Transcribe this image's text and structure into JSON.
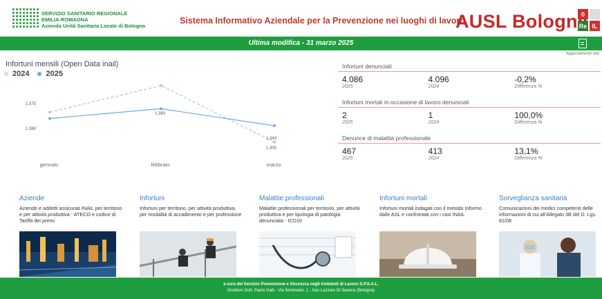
{
  "header": {
    "org_line1": "SERVIZIO SANITARIO REGIONALE",
    "org_line2": "EMILIA-ROMAGNA",
    "org_line3": "Azienda Unità Sanitaria Locale di Bologna",
    "title": "Sistema Informativo Aziendale per la Prevenzione nei luoghi di lavoro",
    "brand": "AUSL Bologna",
    "badge": {
      "zero": "0",
      "re": "Re",
      "il": "IL"
    },
    "brand_color": "#c62828"
  },
  "banner": {
    "last_modified": "Ultima modifica  -  31 marzo 2025",
    "update_label": "Aggiornamento dati",
    "color": "#1f9e3f"
  },
  "chart_data": {
    "type": "line",
    "title": "Infortuni mensili (Open Data inail)",
    "categories": [
      "gennaio",
      "febbraio",
      "marzo"
    ],
    "series": [
      {
        "name": "2024",
        "values": [
          1375,
          1437,
          1305
        ],
        "color": "#a9cbe6",
        "dashed": true
      },
      {
        "name": "2025",
        "values": [
          1360,
          1383,
          1343
        ],
        "color": "#6fa8dc",
        "dashed": false
      }
    ],
    "data_labels": [
      "1.375",
      "1.360",
      "1.383",
      "1.343",
      "1.305"
    ]
  },
  "stats": [
    {
      "heading": "Infortuni denunciati",
      "values": [
        {
          "value": "4.086",
          "label": "2025"
        },
        {
          "value": "4.096",
          "label": "2024"
        },
        {
          "value": "-0,2%",
          "label": "Differenza %"
        }
      ]
    },
    {
      "heading": "Infortuni mortali in occasione di lavoro denunciati",
      "values": [
        {
          "value": "2",
          "label": "2025"
        },
        {
          "value": "1",
          "label": "2024"
        },
        {
          "value": "100,0%",
          "label": "Differenza %"
        }
      ]
    },
    {
      "heading": "Denunce di malattia professionale",
      "values": [
        {
          "value": "467",
          "label": "2025"
        },
        {
          "value": "413",
          "label": "2024"
        },
        {
          "value": "13,1%",
          "label": "Differenza %"
        }
      ]
    }
  ],
  "cards": [
    {
      "title": "Aziende",
      "desc": "Aziende e addetti assicurati INAIL per territorio e per attività produttiva - ATECO e codice di Tariffa dei premi",
      "image": "industrial-plant-image"
    },
    {
      "title": "Infortuni",
      "desc": "Infortuni per territorio, per attività produttiva, per modalità di accadimento e per professione",
      "image": "construction-workers-image"
    },
    {
      "title": "Malattie professionali",
      "desc": "Malattie professionali per territorio, per attività produttiva e per tipologia di patologia denunciata - ICD10",
      "image": "stethoscope-image"
    },
    {
      "title": "Infortuni mortali",
      "desc": "Infortuni mortali indagati con il metodo Informo dalle ASL e confrontati con i casi INAIL",
      "image": "hard-hat-image"
    },
    {
      "title": "Sorveglianza sanitaria",
      "desc": "Comunicazioni dei medici competenti delle informazioni di cui all'Allegato 3B del D. Lgs. 81/08",
      "image": "doctors-image"
    }
  ],
  "footer": {
    "line1": "a cura del Servizio Prevenzione e Sicurezza negli Ambienti di Lavoro S.P.S.A.L.",
    "line2": "Direttore Dott. Paolo Galli - Via Seminario, 1 - San Lazzaro Di Savena (Bologna)"
  }
}
